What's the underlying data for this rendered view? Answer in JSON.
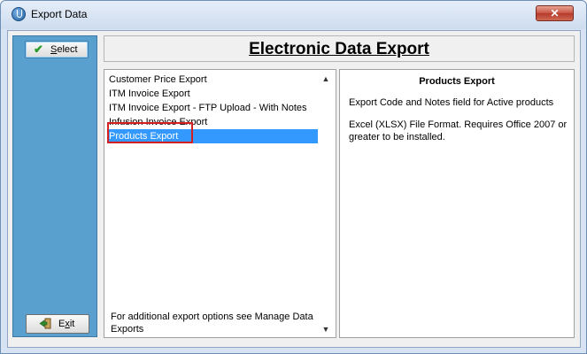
{
  "window": {
    "title": "Export Data",
    "close_label": "✕"
  },
  "sidebar": {
    "select_label_u": "S",
    "select_label_rest": "elect",
    "exit_label_u": "x",
    "exit_label_pre": "E",
    "exit_label_rest": "it"
  },
  "header": {
    "title": "Electronic Data Export"
  },
  "export_list": {
    "items": [
      "Customer Price Export",
      "ITM Invoice Export",
      "ITM Invoice Export - FTP Upload - With Notes",
      "Infusion Invoice Export",
      "Products Export"
    ],
    "selected_index": 4,
    "footer": "For additional export options see Manage Data Exports"
  },
  "detail": {
    "title": "Products Export",
    "line1": "Export Code and Notes field for Active products",
    "line2": "Excel (XLSX) File Format.  Requires Office 2007 or greater to be installed."
  },
  "icons": {
    "app": "power-icon",
    "select": "checkmark-icon",
    "exit": "exit-door-icon",
    "scroll_up": "chevron-up-icon",
    "scroll_down": "chevron-down-icon"
  },
  "colors": {
    "sidebar": "#5aa0cf",
    "selection": "#3399ff",
    "highlight": "#d42020",
    "close": "#c75243"
  }
}
